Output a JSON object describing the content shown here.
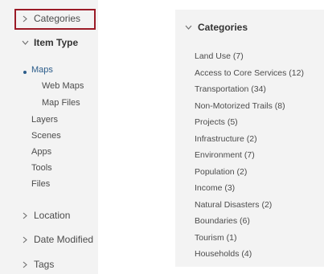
{
  "left_panel": {
    "sections": {
      "categories": "Categories",
      "item_type": "Item Type",
      "location": "Location",
      "date_modified": "Date Modified",
      "tags": "Tags"
    },
    "item_types": {
      "maps": "Maps",
      "web_maps": "Web Maps",
      "map_files": "Map Files",
      "layers": "Layers",
      "scenes": "Scenes",
      "apps": "Apps",
      "tools": "Tools",
      "files": "Files"
    },
    "active_item": "Maps",
    "highlight_color": "#9b1b27",
    "active_color": "#2b5c8a"
  },
  "right_panel": {
    "title": "Categories",
    "categories": [
      "Land Use  (7)",
      "Access to Core Services  (12)",
      "Transportation  (34)",
      "Non-Motorized Trails  (8)",
      "Projects  (5)",
      "Infrastructure  (2)",
      "Environment  (7)",
      "Population  (2)",
      "Income  (3)",
      "Natural Disasters  (2)",
      "Boundaries  (6)",
      "Tourism  (1)",
      "Households  (4)"
    ]
  },
  "icons": {
    "collapsed": "chevron-right-icon",
    "expanded": "chevron-down-icon"
  }
}
